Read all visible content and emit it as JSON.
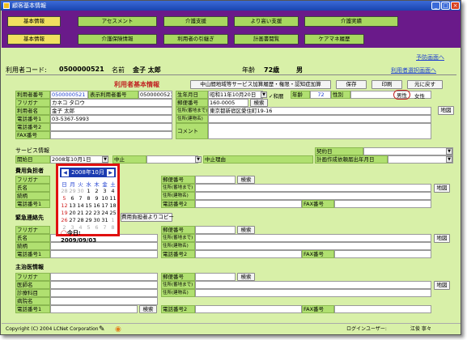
{
  "window": {
    "title": "顧客基本情報"
  },
  "nav": {
    "row1": [
      "基本情報",
      "アセスメント",
      "介護支援",
      "より高い支援",
      "介護実績"
    ],
    "row2": [
      "基本情報",
      "介護保険情報",
      "利用者の引継ぎ",
      "計画書閲覧",
      "ケアマネ履歴"
    ]
  },
  "links": {
    "yobou": "予防画面へ",
    "select": "利用者選択画面へ"
  },
  "header": {
    "code_label": "利用者コード:",
    "code": "0500000521",
    "name_label": "名前",
    "name": "金子 太郎",
    "age_label": "年齢",
    "age": "72歳",
    "sex": "男"
  },
  "section_title": "利用者基本情報",
  "toolbar": {
    "add_service": "中山間地域等サービス加算履歴・権限・認知症加算",
    "save": "保存",
    "print": "印刷",
    "back": "元に戻す"
  },
  "basic": {
    "user_no_label": "利用者番号",
    "user_no": "0500000521",
    "disp_no_label": "表示利用者番号",
    "disp_no": "0500000521",
    "birth_label": "生年月日",
    "birth": "昭和11年10月20日",
    "era_label": "✓和暦",
    "age_label": "年齢",
    "age": "72",
    "sex_label": "性別",
    "sex_opt1": "男性",
    "sex_opt2": "女性",
    "furigana_label": "フリガナ",
    "furigana": "カネコ タロウ",
    "postal_label": "郵便番号",
    "postal": "160-0005",
    "search": "検索",
    "name_label": "利用者名",
    "name": "金子 太郎",
    "addr_label": "住所(番地まで)",
    "addr": "東京都新宿区愛住町19-16",
    "map": "地図",
    "tel1_label": "電話番号1",
    "tel1": "03-5367-5993",
    "addr2_label": "住所(建物名)",
    "tel2_label": "電話番号2",
    "comment_label": "コメント",
    "fax_label": "FAX番号"
  },
  "service": {
    "title": "サービス情報",
    "start_label": "開始日",
    "start_value": "2008年10月1日",
    "stop_label": "中止",
    "stop_reason_label": "中止理由",
    "contract_label": "契約日",
    "plan_label": "計画作成依頼届出年月日"
  },
  "payer": {
    "title": "費用負担者",
    "furigana_label": "フリガナ",
    "postal_label": "郵便番号",
    "search": "検索",
    "name_label": "氏名",
    "addr_label": "住所(番地まで)",
    "map": "地図",
    "rel_label": "続柄",
    "addr2_label": "住所(建物名)",
    "tel1_label": "電話番号1",
    "tel2_label": "電話番号2",
    "fax_label": "FAX番号"
  },
  "emergency": {
    "title": "緊急連絡先",
    "copy_label": "費用負担者よりコピー",
    "furigana_label": "フリガナ",
    "postal_label": "郵便番号",
    "search": "検索",
    "name_label": "氏名",
    "addr_label": "住所(番地まで)",
    "map": "地図",
    "rel_label": "続柄",
    "addr2_label": "住所(建物名)",
    "tel1_label": "電話番号1",
    "tel2_label": "電話番号2",
    "fax_label": "FAX番号"
  },
  "doctor": {
    "title": "主治医情報",
    "furigana_label": "フリガナ",
    "postal_label": "郵便番号",
    "search": "検索",
    "name_label": "医師名",
    "addr_label": "住所(番地まで)",
    "map": "地図",
    "dept_label": "診療科目",
    "addr2_label": "住所(建物名)",
    "hosp_label": "病院名",
    "tel1_label": "電話番号1",
    "tel2_label": "電話番号2",
    "fax_label": "FAX番号"
  },
  "calendar": {
    "month": "2008年10月",
    "prev": "◀",
    "next": "▶",
    "dow": [
      "日",
      "月",
      "火",
      "水",
      "木",
      "金",
      "土"
    ],
    "weeks": [
      [
        "28",
        "29",
        "30",
        "1",
        "2",
        "3",
        "4"
      ],
      [
        "5",
        "6",
        "7",
        "8",
        "9",
        "10",
        "11"
      ],
      [
        "12",
        "13",
        "14",
        "15",
        "16",
        "17",
        "18"
      ],
      [
        "19",
        "20",
        "21",
        "22",
        "23",
        "24",
        "25"
      ],
      [
        "26",
        "27",
        "28",
        "29",
        "30",
        "31",
        "1"
      ],
      [
        "2",
        "3",
        "4",
        "5",
        "6",
        "7",
        "8"
      ]
    ],
    "today": "今日: 2009/09/03"
  },
  "status": {
    "copyright": "Copyright (C) 2004 LCNet Corporation",
    "login_label": "ログインユーザー:",
    "login_user": "江俊 寧々"
  }
}
